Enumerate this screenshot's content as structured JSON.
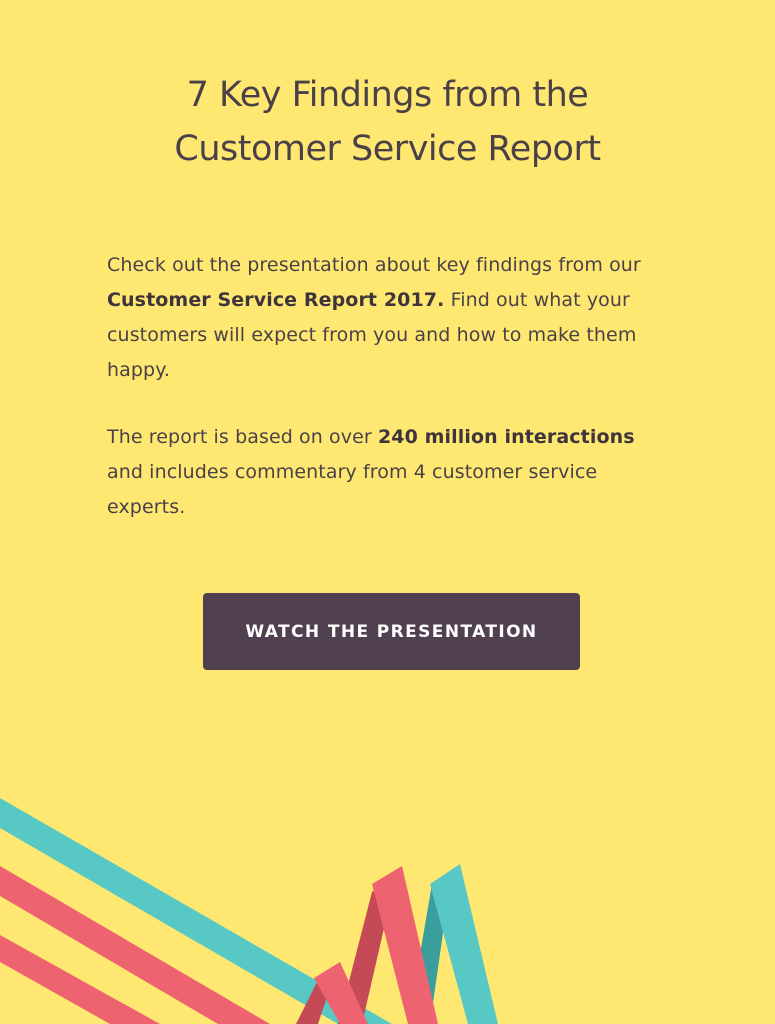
{
  "header": {
    "title_line1": "7 Key Findings from the",
    "title_line2": "Customer Service Report"
  },
  "intro": {
    "p1_part1": "Check out the presentation about key findings from our ",
    "p1_bold": "Customer Service Report 2017.",
    "p1_part2": " Find out what your customers will expect from you and how to make them happy.",
    "p2_part1": "The report is based on over ",
    "p2_bold": "240 million interactions",
    "p2_part2": " and includes commentary from 4 customer service experts."
  },
  "cta": {
    "label": "WATCH THE PRESENTATION"
  },
  "colors": {
    "background": "#FFE871",
    "text": "#4A4148",
    "button": "#514150",
    "ribbon_teal": "#58C8C4",
    "ribbon_teal_dark": "#3A9E9C",
    "ribbon_coral": "#EE6370",
    "ribbon_coral_dark": "#C54A57"
  }
}
